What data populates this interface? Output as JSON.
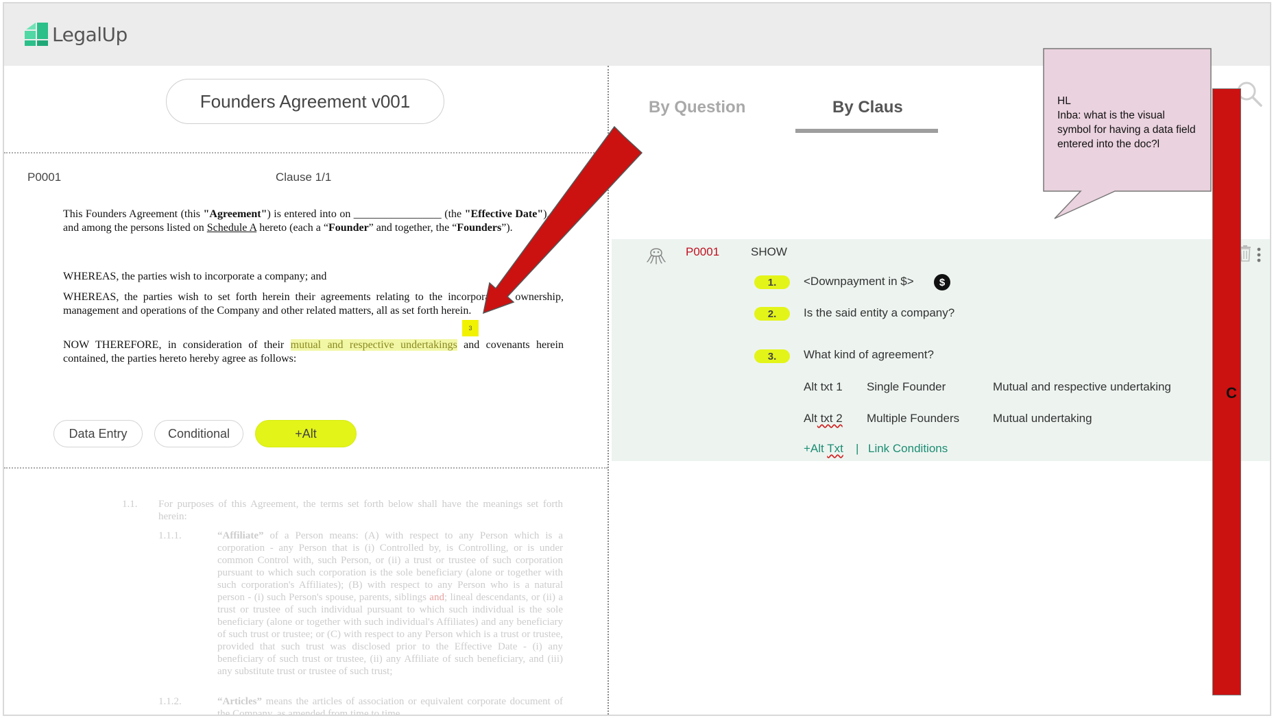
{
  "app": {
    "name": "LegalUp",
    "brand_color": "#2bbf8a"
  },
  "document": {
    "title": "Founders Agreement v001",
    "clause_id": "P0001",
    "clause_count": "Clause 1/1",
    "marker": "3",
    "p1": {
      "a": "This Founders Agreement (this ",
      "b1": "\"Agreement\"",
      "c": ") is entered into on ________________ (the ",
      "b2": "\"Effective Date\"",
      "d": "), by and among the persons listed on ",
      "u": "Schedule A",
      "e": " hereto (each a “",
      "b3": "Founder",
      "f": "” and together, the “",
      "b4": "Founders",
      "g": "”)."
    },
    "p2": "WHEREAS, the parties wish to incorporate a company; and",
    "p3": "WHEREAS, the parties wish to set forth herein their agreements relating to the incorporation, ownership, management and operations of the Company and other related matters, all as set forth herein.",
    "p4": {
      "a": "NOW THEREFORE, in consideration of their ",
      "hl": "mutual and respective undertakings",
      "b": " and covenants herein contained, the parties hereto hereby agree as follows:"
    },
    "buttons": {
      "data_entry": "Data Entry",
      "conditional": "Conditional",
      "alt": "+Alt"
    },
    "faded": {
      "n11": "1.1.",
      "t11": "For purposes of this Agreement, the terms set forth below shall have the meanings set forth herein:",
      "n111": "1.1.1.",
      "t111_b": "“Affiliate”",
      "t111_a": " of a Person means: (A) with respect to any Person which is a corporation - any Person that is (i) Controlled by, is Controlling, or is under common Control with, such Person, or (ii) a trust or trustee of such corporation pursuant to which such corporation is the sole beneficiary (alone or together with such corporation's Affiliates); (B) with respect to any Person who is a natural person - (i) such Person's spouse, parents, siblings ",
      "t111_red": "and",
      "t111_c": "; lineal descendants, or (ii) a trust or trustee of such individual pursuant to which such individual is the sole beneficiary (alone or together with such individual's Affiliates) and any beneficiary of such trust or trustee; or (C) with respect to any Person which is a trust or trustee, provided that such trust was disclosed prior to the Effective Date - (i) any beneficiary of such trust or trustee, (ii) any Affiliate of such beneficiary, and (iii) any substitute trust or trustee of such trust;",
      "n112": "1.1.2.",
      "t112_b": "“Articles”",
      "t112_a": " means the articles of association or equivalent corporate document of the Company, as amended from time to time."
    }
  },
  "tabs": {
    "by_question": "By Question",
    "by_claus": "By Claus"
  },
  "clause_panel": {
    "id": "P0001",
    "action": "SHOW",
    "questions": [
      {
        "num": "1.",
        "text": "<Downpayment in $>"
      },
      {
        "num": "2.",
        "text": "Is the said entity a company?"
      },
      {
        "num": "3.",
        "text": "What kind of agreement?"
      }
    ],
    "alts": [
      {
        "label_a": "Alt",
        "label_b": " txt 1",
        "option": "Single Founder",
        "text": "Mutual and respective undertaking"
      },
      {
        "label_a": "Alt",
        "label_b": " txt 2",
        "option": "Multiple Founders",
        "text": "Mutual undertaking"
      }
    ],
    "links": {
      "alt_a": "+Alt ",
      "alt_b": "Txt",
      "separator": "|",
      "link_conditions": "Link Conditions"
    }
  },
  "annotation": {
    "callout_lines": [
      "HL",
      "Inba: what is the visual symbol for having a data field entered into the doc?l"
    ],
    "bar_label": "C",
    "arrow_color": "#cc1111",
    "callout_color": "#ead2de"
  }
}
